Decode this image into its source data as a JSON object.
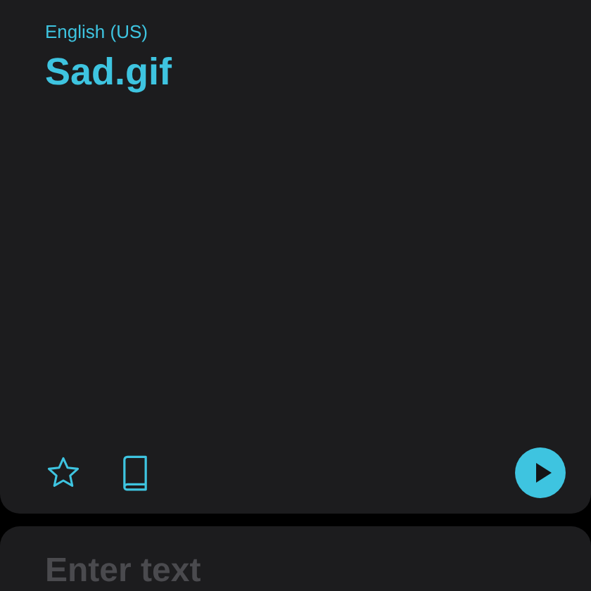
{
  "result": {
    "language": "English (US)",
    "text": "Sad.gif",
    "favorite": false
  },
  "input": {
    "placeholder": "Enter text"
  }
}
